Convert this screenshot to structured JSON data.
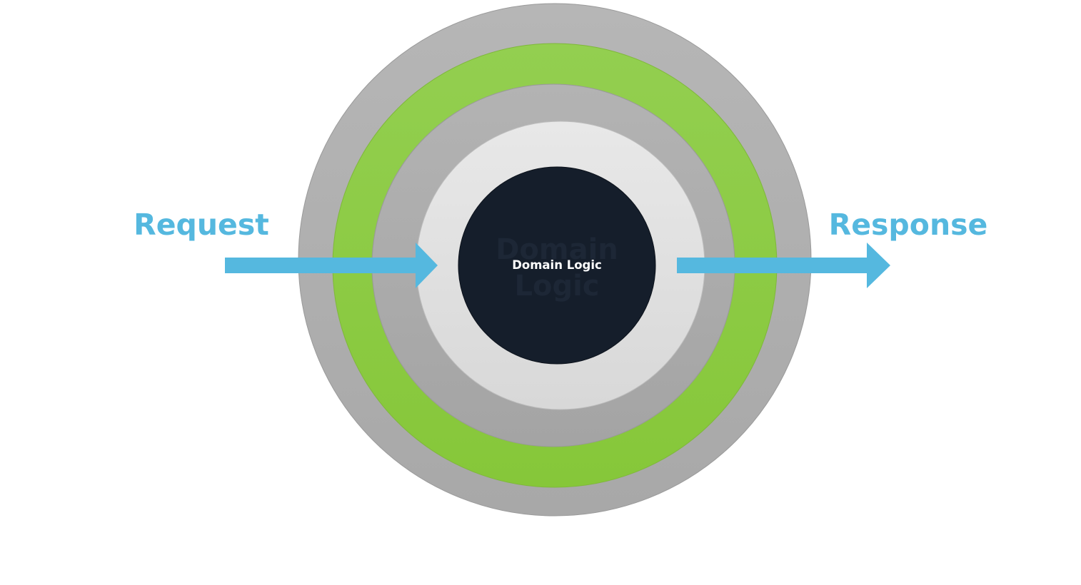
{
  "diagram": {
    "core_label": "Domain Logic",
    "ghost_lines": [
      "Domain",
      "Logic"
    ],
    "request_label": "Request",
    "response_label": "Response"
  },
  "colors": {
    "outer_ring": "#b0b0b0",
    "green_ring": "#8dc843",
    "inner_gray_ring": "#ababab",
    "light_ring": "#e2e2e2",
    "core": "#151e2b",
    "core_text": "#ffffff",
    "arrow": "#55b8df"
  }
}
